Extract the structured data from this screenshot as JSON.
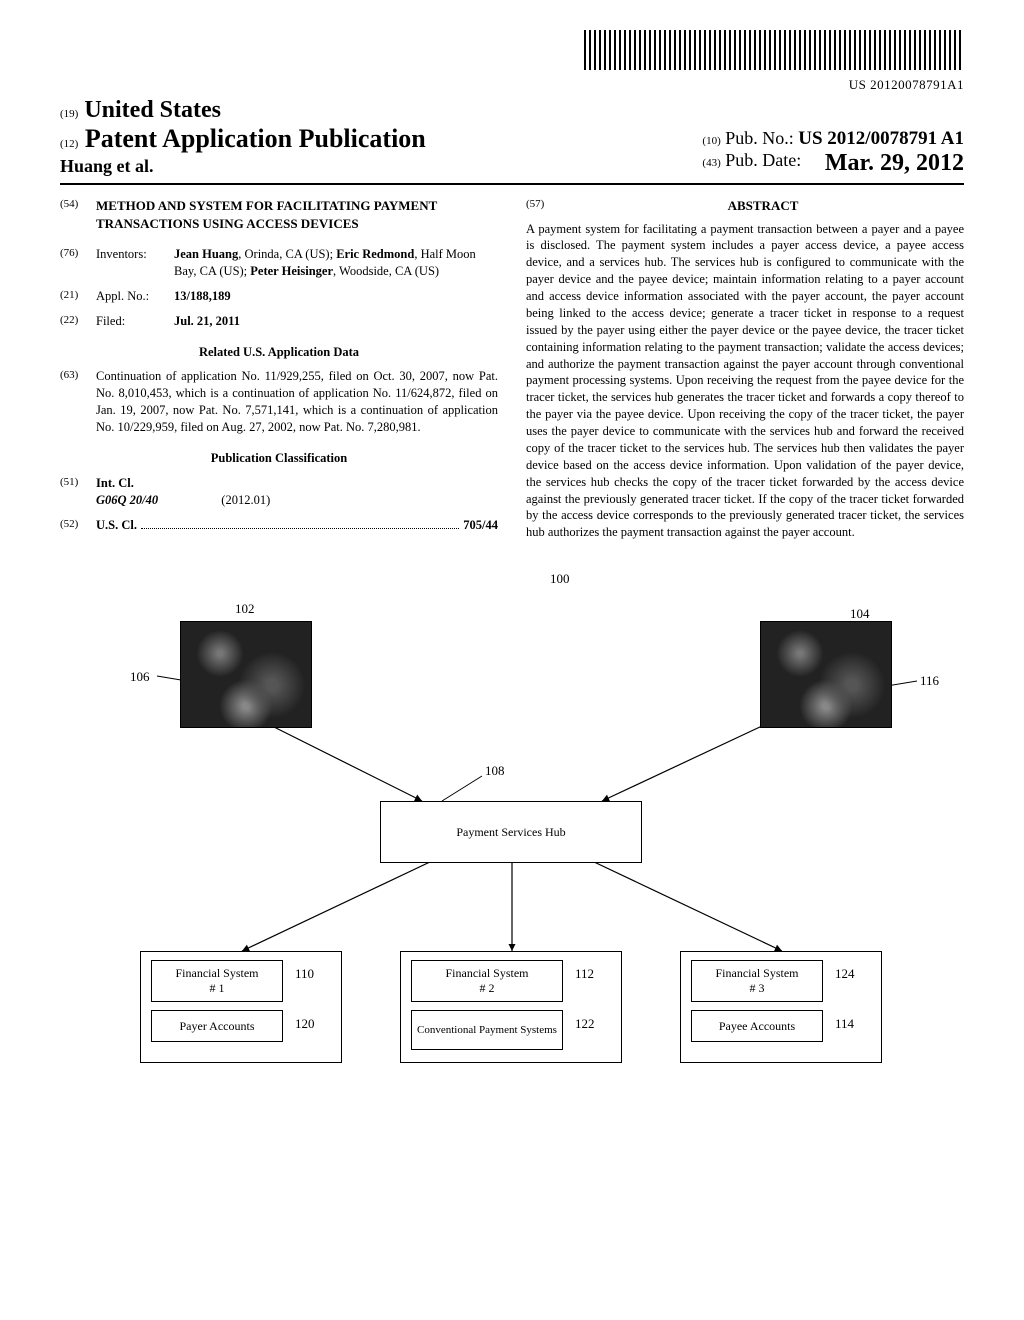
{
  "barcode_text": "US 20120078791A1",
  "header": {
    "country_inid": "(19)",
    "country": "United States",
    "pub_type_inid": "(12)",
    "pub_type": "Patent Application Publication",
    "author": "Huang et al.",
    "pub_no_inid": "(10)",
    "pub_no_label": "Pub. No.:",
    "pub_no_value": "US 2012/0078791 A1",
    "pub_date_inid": "(43)",
    "pub_date_label": "Pub. Date:",
    "pub_date_value": "Mar. 29, 2012"
  },
  "title": {
    "inid": "(54)",
    "text": "METHOD AND SYSTEM FOR FACILITATING PAYMENT TRANSACTIONS USING ACCESS DEVICES"
  },
  "inventors": {
    "inid": "(76)",
    "label": "Inventors:",
    "value_html": "Jean Huang, Orinda, CA (US); Eric Redmond, Half Moon Bay, CA (US); Peter Heisinger, Woodside, CA (US)",
    "names": [
      "Jean Huang",
      "Eric Redmond",
      "Peter Heisinger"
    ]
  },
  "appl_no": {
    "inid": "(21)",
    "label": "Appl. No.:",
    "value": "13/188,189"
  },
  "filed": {
    "inid": "(22)",
    "label": "Filed:",
    "value": "Jul. 21, 2011"
  },
  "related_heading": "Related U.S. Application Data",
  "related": {
    "inid": "(63)",
    "text": "Continuation of application No. 11/929,255, filed on Oct. 30, 2007, now Pat. No. 8,010,453, which is a continuation of application No. 11/624,872, filed on Jan. 19, 2007, now Pat. No. 7,571,141, which is a continuation of application No. 10/229,959, filed on Aug. 27, 2002, now Pat. No. 7,280,981."
  },
  "pub_class_heading": "Publication Classification",
  "int_cl": {
    "inid": "(51)",
    "label": "Int. Cl.",
    "code": "G06Q 20/40",
    "version": "(2012.01)"
  },
  "us_cl": {
    "inid": "(52)",
    "label": "U.S. Cl.",
    "value": "705/44"
  },
  "abstract": {
    "inid": "(57)",
    "heading": "ABSTRACT",
    "text": "A payment system for facilitating a payment transaction between a payer and a payee is disclosed. The payment system includes a payer access device, a payee access device, and a services hub. The services hub is configured to communicate with the payer device and the payee device; maintain information relating to a payer account and access device information associated with the payer account, the payer account being linked to the access device; generate a tracer ticket in response to a request issued by the payer using either the payer device or the payee device, the tracer ticket containing information relating to the payment transaction; validate the access devices; and authorize the payment transaction against the payer account through conventional payment processing systems. Upon receiving the request from the payee device for the tracer ticket, the services hub generates the tracer ticket and forwards a copy thereof to the payer via the payee device. Upon receiving the copy of the tracer ticket, the payer uses the payer device to communicate with the services hub and forward the received copy of the tracer ticket to the services hub. The services hub then validates the payer device based on the access device information. Upon validation of the payer device, the services hub checks the copy of the tracer ticket forwarded by the access device against the previously generated tracer ticket. If the copy of the tracer ticket forwarded by the access device corresponds to the previously generated tracer ticket, the services hub authorizes the payment transaction against the payer account."
  },
  "figure": {
    "ref_100": "100",
    "ref_102": "102",
    "ref_104": "104",
    "ref_106": "106",
    "ref_108": "108",
    "ref_110": "110",
    "ref_112": "112",
    "ref_114": "114",
    "ref_116": "116",
    "ref_120": "120",
    "ref_122": "122",
    "ref_124": "124",
    "hub_label": "Payment Services Hub",
    "fs1_label": "Financial System\n# 1",
    "fs2_label": "Financial System\n# 2",
    "fs3_label": "Financial System\n# 3",
    "payer_acc_label": "Payer Accounts",
    "conv_pay_label": "Conventional Payment Systems",
    "payee_acc_label": "Payee Accounts"
  }
}
